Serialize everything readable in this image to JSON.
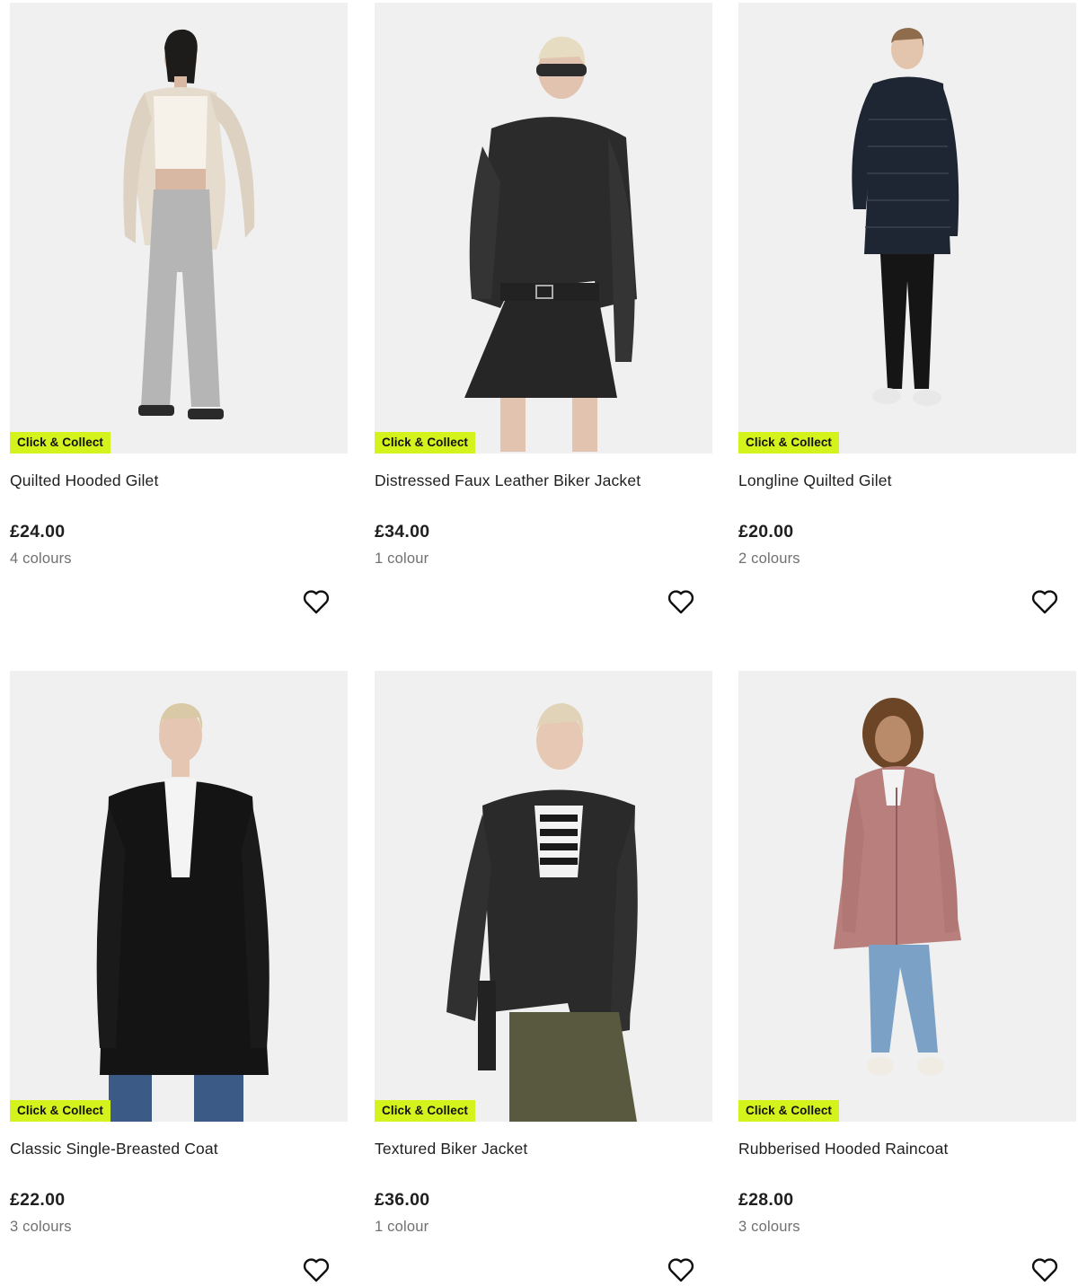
{
  "colors": {
    "badge_bg": "#d4f21c",
    "image_bg": "#efefef",
    "text": "#1f1f1f",
    "muted": "#707070"
  },
  "products": [
    {
      "badge": "Click & Collect",
      "title": "Quilted Hooded Gilet",
      "price": "£24.00",
      "colours": "4 colours",
      "image": "model-wearing-cream-quilted-gilet-and-grey-wide-jeans",
      "wishlist_icon": "heart-outline-icon"
    },
    {
      "badge": "Click & Collect",
      "title": "Distressed Faux Leather Biker Jacket",
      "price": "£34.00",
      "colours": "1 colour",
      "image": "model-wearing-black-leather-biker-jacket-and-pleated-skirt",
      "wishlist_icon": "heart-outline-icon"
    },
    {
      "badge": "Click & Collect",
      "title": "Longline Quilted Gilet",
      "price": "£20.00",
      "colours": "2 colours",
      "image": "model-wearing-navy-longline-quilted-gilet",
      "wishlist_icon": "heart-outline-icon"
    },
    {
      "badge": "Click & Collect",
      "title": "Classic Single-Breasted Coat",
      "price": "£22.00",
      "colours": "3 colours",
      "image": "model-wearing-black-single-breasted-coat",
      "wishlist_icon": "heart-outline-icon"
    },
    {
      "badge": "Click & Collect",
      "title": "Textured Biker Jacket",
      "price": "£36.00",
      "colours": "1 colour",
      "image": "model-wearing-black-textured-biker-jacket-and-khaki-skirt",
      "wishlist_icon": "heart-outline-icon"
    },
    {
      "badge": "Click & Collect",
      "title": "Rubberised Hooded Raincoat",
      "price": "£28.00",
      "colours": "3 colours",
      "image": "model-wearing-pink-hooded-raincoat-and-jeans",
      "wishlist_icon": "heart-outline-icon"
    }
  ]
}
